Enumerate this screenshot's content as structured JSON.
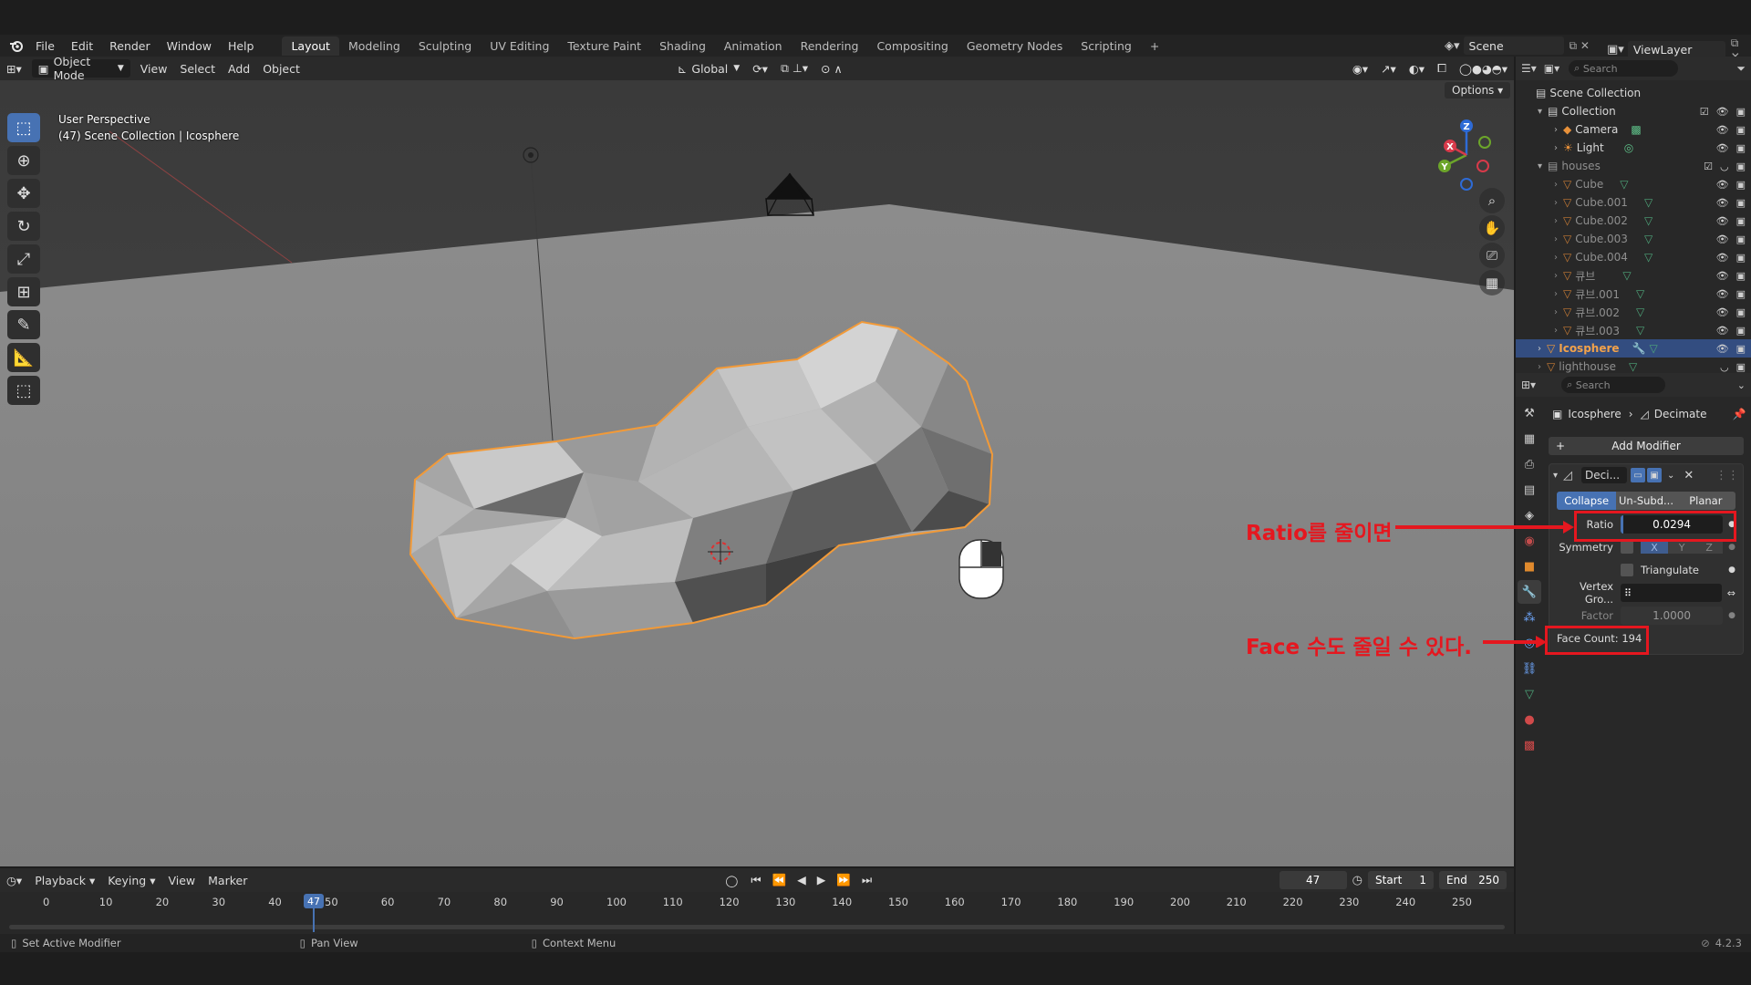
{
  "menubar": {
    "items": [
      "File",
      "Edit",
      "Render",
      "Window",
      "Help"
    ],
    "workspaces": [
      "Layout",
      "Modeling",
      "Sculpting",
      "UV Editing",
      "Texture Paint",
      "Shading",
      "Animation",
      "Rendering",
      "Compositing",
      "Geometry Nodes",
      "Scripting"
    ],
    "active_workspace": "Layout",
    "add_tab": "+",
    "scene": "Scene",
    "view_layer": "ViewLayer"
  },
  "viewport_header": {
    "mode": "Object Mode",
    "menus": [
      "View",
      "Select",
      "Add",
      "Object"
    ],
    "transform_orientation": "Global",
    "options": "Options"
  },
  "viewport": {
    "perspective": "User Perspective",
    "context": "(47) Scene Collection | Icosphere",
    "gizmo_axes": [
      "X",
      "Y",
      "Z"
    ]
  },
  "outliner": {
    "search_placeholder": "Search",
    "root": "Scene Collection",
    "items": [
      {
        "name": "Collection",
        "type": "collection",
        "depth": 1
      },
      {
        "name": "Camera",
        "type": "camera",
        "depth": 2
      },
      {
        "name": "Light",
        "type": "light",
        "depth": 2
      },
      {
        "name": "houses",
        "type": "collection",
        "depth": 1
      },
      {
        "name": "Cube",
        "type": "mesh",
        "depth": 2
      },
      {
        "name": "Cube.001",
        "type": "mesh",
        "depth": 2
      },
      {
        "name": "Cube.002",
        "type": "mesh",
        "depth": 2
      },
      {
        "name": "Cube.003",
        "type": "mesh",
        "depth": 2
      },
      {
        "name": "Cube.004",
        "type": "mesh",
        "depth": 2
      },
      {
        "name": "큐브",
        "type": "mesh",
        "depth": 2
      },
      {
        "name": "큐브.001",
        "type": "mesh",
        "depth": 2
      },
      {
        "name": "큐브.002",
        "type": "mesh",
        "depth": 2
      },
      {
        "name": "큐브.003",
        "type": "mesh",
        "depth": 2
      },
      {
        "name": "Icosphere",
        "type": "mesh",
        "depth": 1,
        "selected": true
      },
      {
        "name": "lighthouse",
        "type": "mesh",
        "depth": 1
      }
    ]
  },
  "properties": {
    "search_placeholder": "Search",
    "breadcrumb_object": "Icosphere",
    "breadcrumb_modifier": "Decimate",
    "add_modifier": "Add Modifier",
    "modifier_name": "Deci...",
    "modes": [
      "Collapse",
      "Un-Subd...",
      "Planar"
    ],
    "active_mode": "Collapse",
    "ratio_label": "Ratio",
    "ratio_value": "0.0294",
    "symmetry_label": "Symmetry",
    "symmetry_axes": [
      "X",
      "Y",
      "Z"
    ],
    "triangulate_label": "Triangulate",
    "vertex_group_label": "Vertex Gro...",
    "factor_label": "Factor",
    "factor_value": "1.0000",
    "face_count": "Face Count: 194"
  },
  "annotations": {
    "ratio_note": "Ratio를 줄이면",
    "face_note": "Face 수도 줄일 수 있다."
  },
  "timeline": {
    "menus": [
      "Playback",
      "Keying",
      "View",
      "Marker"
    ],
    "current_frame": "47",
    "start_label": "Start",
    "start_value": "1",
    "end_label": "End",
    "end_value": "250",
    "ticks": [
      "0",
      "10",
      "20",
      "30",
      "40",
      "50",
      "60",
      "70",
      "80",
      "90",
      "100",
      "110",
      "120",
      "130",
      "140",
      "150",
      "160",
      "170",
      "180",
      "190",
      "200",
      "210",
      "220",
      "230",
      "240",
      "250"
    ],
    "playhead_label": "47"
  },
  "statusbar": {
    "left": "Set Active Modifier",
    "middle": "Pan View",
    "right": "Context Menu",
    "version": "4.2.3"
  },
  "colors": {
    "accent": "#4772b3",
    "selection_outline": "#f29a38",
    "annotation_red": "#e5171f",
    "playhead": "#4772b3"
  }
}
